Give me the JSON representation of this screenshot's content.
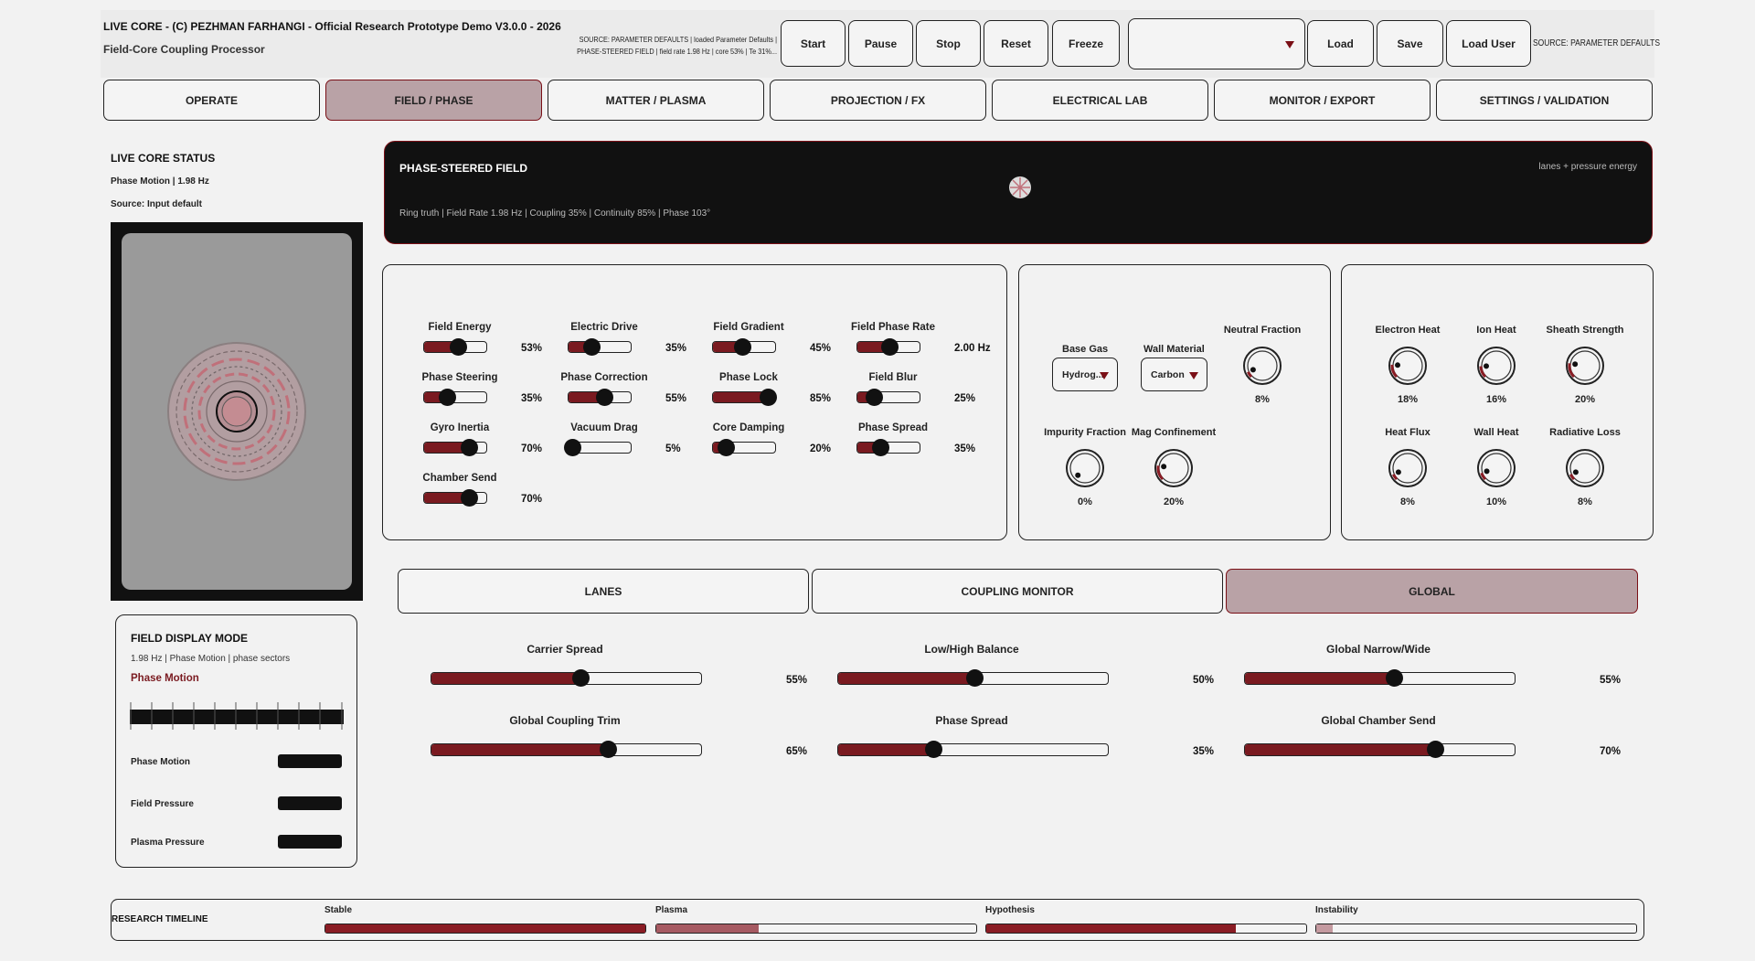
{
  "header": {
    "title": "LIVE CORE - (C) PEZHMAN FARHANGI - Official Research Prototype Demo V3.0.0 - 2026",
    "subtitle": "Field-Core Coupling Processor",
    "source_line1": "SOURCE: PARAMETER DEFAULTS  |  loaded Parameter Defaults  |",
    "source_line2": "PHASE-STEERED FIELD  |  field rate 1.98 Hz  |  core 53%  |  Te 31%...",
    "buttons": {
      "start": "Start",
      "pause": "Pause",
      "stop": "Stop",
      "reset": "Reset",
      "freeze": "Freeze",
      "load": "Load",
      "save": "Save",
      "load_user": "Load User"
    },
    "preset_value": "",
    "source_right": "SOURCE: PARAMETER DEFAULTS"
  },
  "tabs": [
    "OPERATE",
    "FIELD / PHASE",
    "MATTER / PLASMA",
    "PROJECTION / FX",
    "ELECTRICAL LAB",
    "MONITOR / EXPORT",
    "SETTINGS / VALIDATION"
  ],
  "active_tab": 1,
  "status": {
    "title": "LIVE CORE STATUS",
    "line1": "Phase Motion  |  1.98 Hz",
    "line2": "Source: Input default"
  },
  "banner": {
    "title": "PHASE-STEERED FIELD",
    "right": "lanes + pressure energy",
    "info": "Ring truth  |  Field Rate 1.98 Hz  |  Coupling 35%  |  Continuity 85%  |  Phase 103°"
  },
  "field_sliders": [
    {
      "name": "Field Energy",
      "value": "53%",
      "level": 0.53
    },
    {
      "name": "Electric Drive",
      "value": "35%",
      "level": 0.35
    },
    {
      "name": "Field Gradient",
      "value": "45%",
      "level": 0.45
    },
    {
      "name": "Field Phase Rate",
      "value": "2.00 Hz",
      "level": 0.5
    },
    {
      "name": "Phase Steering",
      "value": "35%",
      "level": 0.35
    },
    {
      "name": "Phase Correction",
      "value": "55%",
      "level": 0.55
    },
    {
      "name": "Phase Lock",
      "value": "85%",
      "level": 0.85
    },
    {
      "name": "Field Blur",
      "value": "25%",
      "level": 0.25
    },
    {
      "name": "Gyro Inertia",
      "value": "70%",
      "level": 0.7
    },
    {
      "name": "Vacuum Drag",
      "value": "5%",
      "level": 0.05
    },
    {
      "name": "Core Damping",
      "value": "20%",
      "level": 0.2
    },
    {
      "name": "Phase Spread",
      "value": "35%",
      "level": 0.35
    },
    {
      "name": "Chamber Send",
      "value": "70%",
      "level": 0.7
    }
  ],
  "matter": {
    "base_gas_label": "Base Gas",
    "base_gas_value": "Hydrog...",
    "wall_material_label": "Wall Material",
    "wall_material_value": "Carbon",
    "knobs": [
      {
        "name": "Neutral Fraction",
        "value": "8%",
        "level": 0.08
      },
      {
        "name": "Impurity Fraction",
        "value": "0%",
        "level": 0.0
      },
      {
        "name": "Mag Confinement",
        "value": "20%",
        "level": 0.2
      }
    ]
  },
  "plasma_knobs": [
    {
      "name": "Electron Heat",
      "value": "18%",
      "level": 0.18
    },
    {
      "name": "Ion Heat",
      "value": "16%",
      "level": 0.16
    },
    {
      "name": "Sheath Strength",
      "value": "20%",
      "level": 0.2
    },
    {
      "name": "Heat Flux",
      "value": "8%",
      "level": 0.08
    },
    {
      "name": "Wall Heat",
      "value": "10%",
      "level": 0.1
    },
    {
      "name": "Radiative Loss",
      "value": "8%",
      "level": 0.08
    }
  ],
  "subtabs": [
    "LANES",
    "COUPLING MONITOR",
    "GLOBAL"
  ],
  "active_subtab": 2,
  "global_sliders": [
    {
      "name": "Carrier Spread",
      "value": "55%",
      "level": 0.55
    },
    {
      "name": "Low/High Balance",
      "value": "50%",
      "level": 0.5
    },
    {
      "name": "Global Narrow/Wide",
      "value": "55%",
      "level": 0.55
    },
    {
      "name": "Global Coupling Trim",
      "value": "65%",
      "level": 0.65
    },
    {
      "name": "Phase Spread",
      "value": "35%",
      "level": 0.35
    },
    {
      "name": "Global Chamber Send",
      "value": "70%",
      "level": 0.7
    }
  ],
  "display_mode": {
    "title": "FIELD DISPLAY MODE",
    "info": "1.98 Hz   |   Phase Motion   |   phase sectors",
    "mode": "Phase Motion",
    "rows": [
      "Phase Motion",
      "Field Pressure",
      "Plasma Pressure"
    ]
  },
  "timeline": {
    "title": "RESEARCH TIMELINE",
    "items": [
      {
        "name": "Stable",
        "level": 1.0,
        "color": "#8a1c24"
      },
      {
        "name": "Plasma",
        "level": 0.32,
        "color": "#a65a62"
      },
      {
        "name": "Hypothesis",
        "level": 0.78,
        "color": "#8a1c24"
      },
      {
        "name": "Instability",
        "level": 0.05,
        "color": "#c49aa0"
      }
    ]
  },
  "colors": {
    "accent": "#7a1a20",
    "active_tab": "#b9a2a6",
    "banner_bg": "#111111"
  }
}
